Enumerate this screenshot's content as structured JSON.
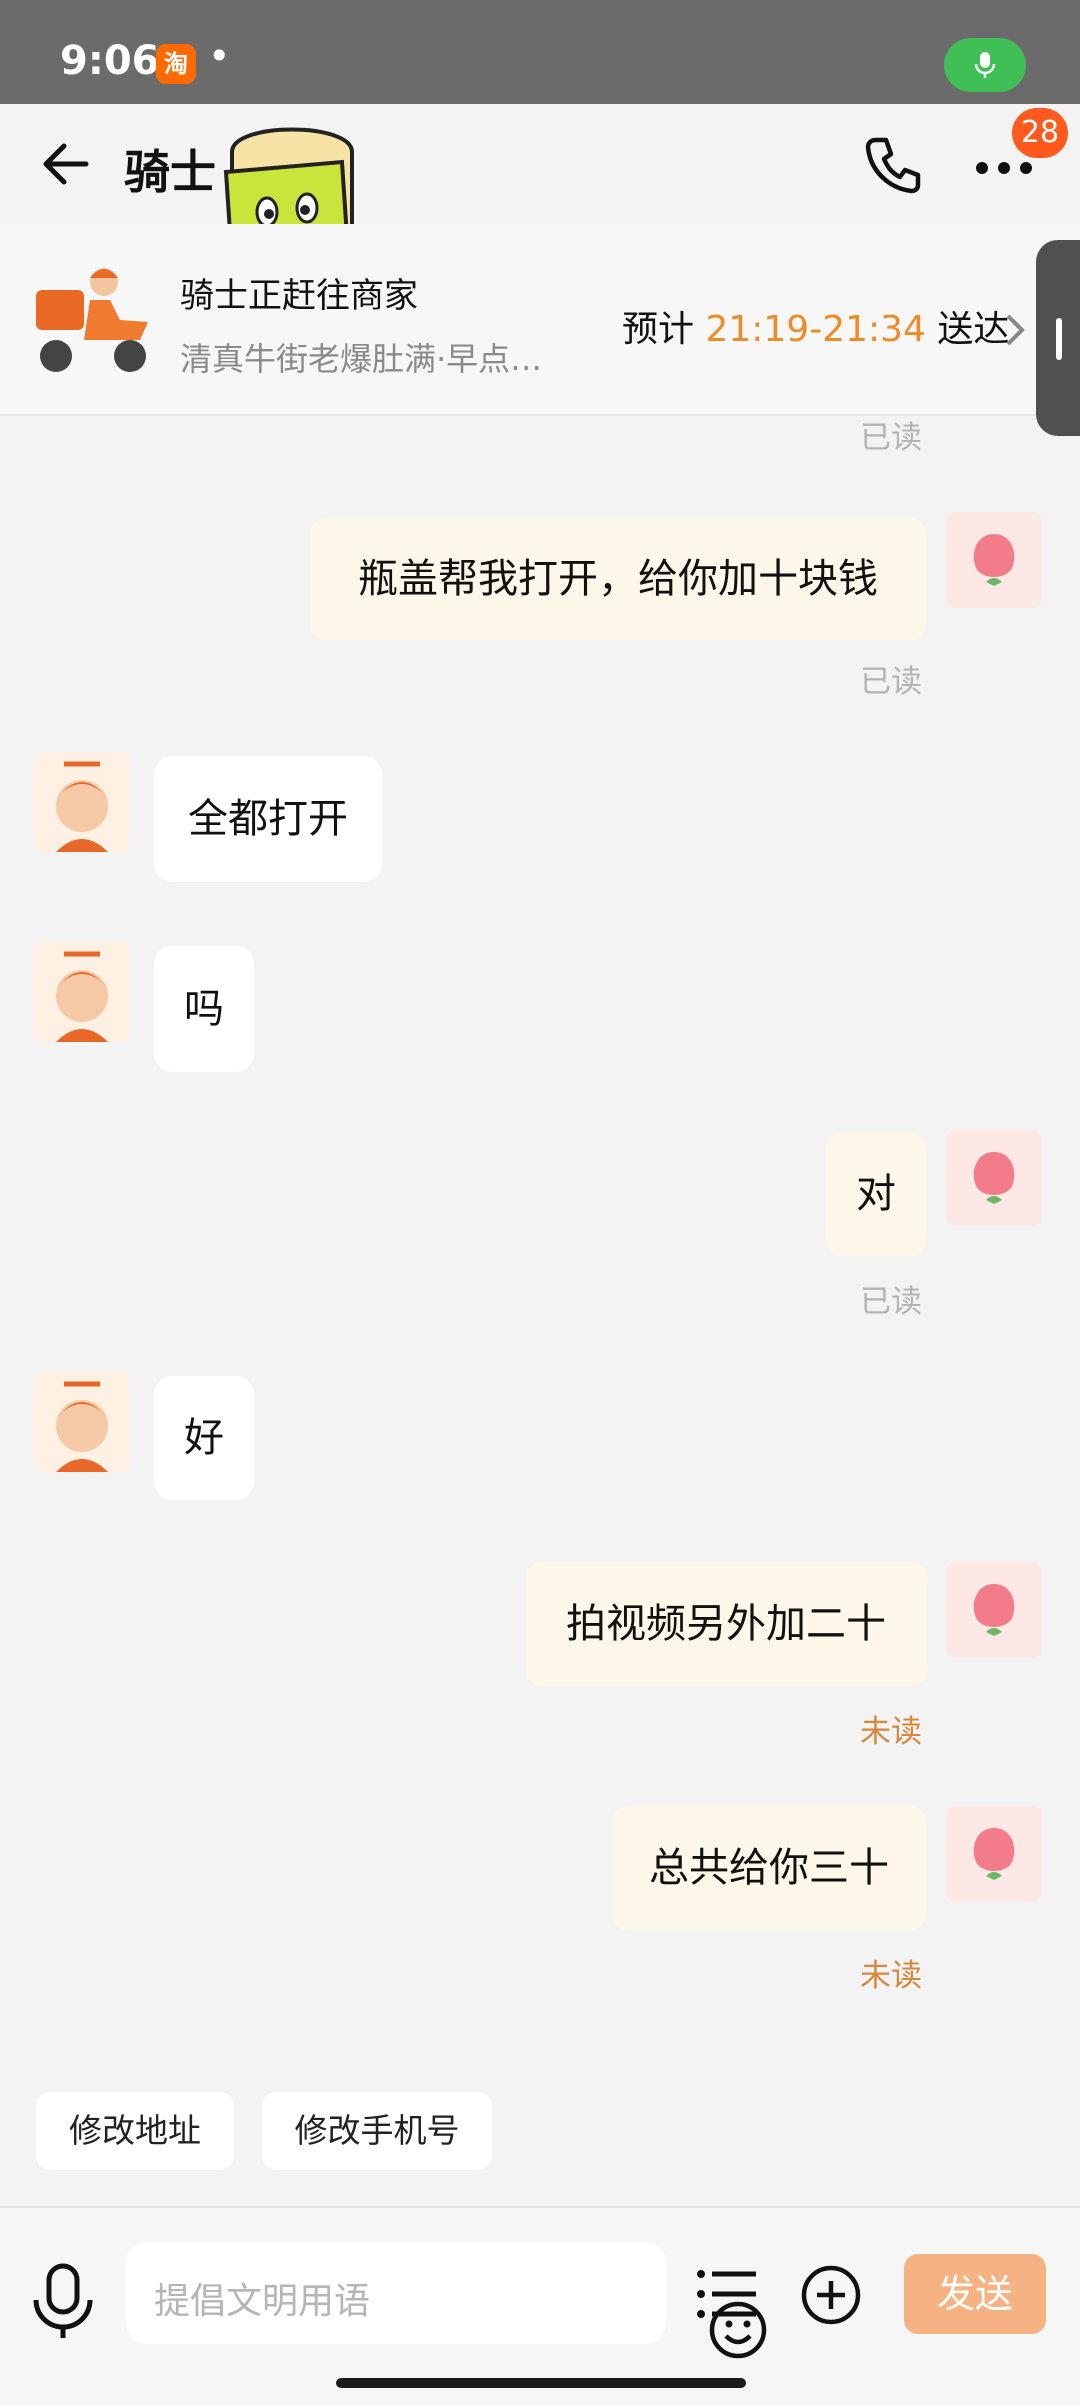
{
  "status_bar": {
    "time": "9:06",
    "app_badge": "淘",
    "dots": "•"
  },
  "header": {
    "title": "骑士",
    "unread_badge": "28"
  },
  "order": {
    "title": "骑士正赶往商家",
    "subtitle": "清真牛街老爆肚满·早点…",
    "eta_prefix": "预计",
    "eta_time": "21:19-21:34",
    "eta_suffix": "送达"
  },
  "messages": [
    {
      "from": "me",
      "text": "",
      "status": "已读"
    },
    {
      "from": "me",
      "text": "瓶盖帮我打开，给你加十块钱",
      "status": "已读"
    },
    {
      "from": "rider",
      "text": "全都打开"
    },
    {
      "from": "rider",
      "text": "吗"
    },
    {
      "from": "me",
      "text": "对",
      "status": "已读"
    },
    {
      "from": "rider",
      "text": "好"
    },
    {
      "from": "me",
      "text": "拍视频另外加二十",
      "status": "未读"
    },
    {
      "from": "me",
      "text": "总共给你三十",
      "status": "未读"
    }
  ],
  "quick_replies": [
    "修改地址",
    "修改手机号"
  ],
  "input": {
    "placeholder": "提倡文明用语",
    "send_label": "发送"
  },
  "colors": {
    "accent": "#f08a24",
    "send_button": "#f6b283",
    "my_bubble": "#fcf7e8",
    "unread_badge": "#ff5a1e"
  }
}
